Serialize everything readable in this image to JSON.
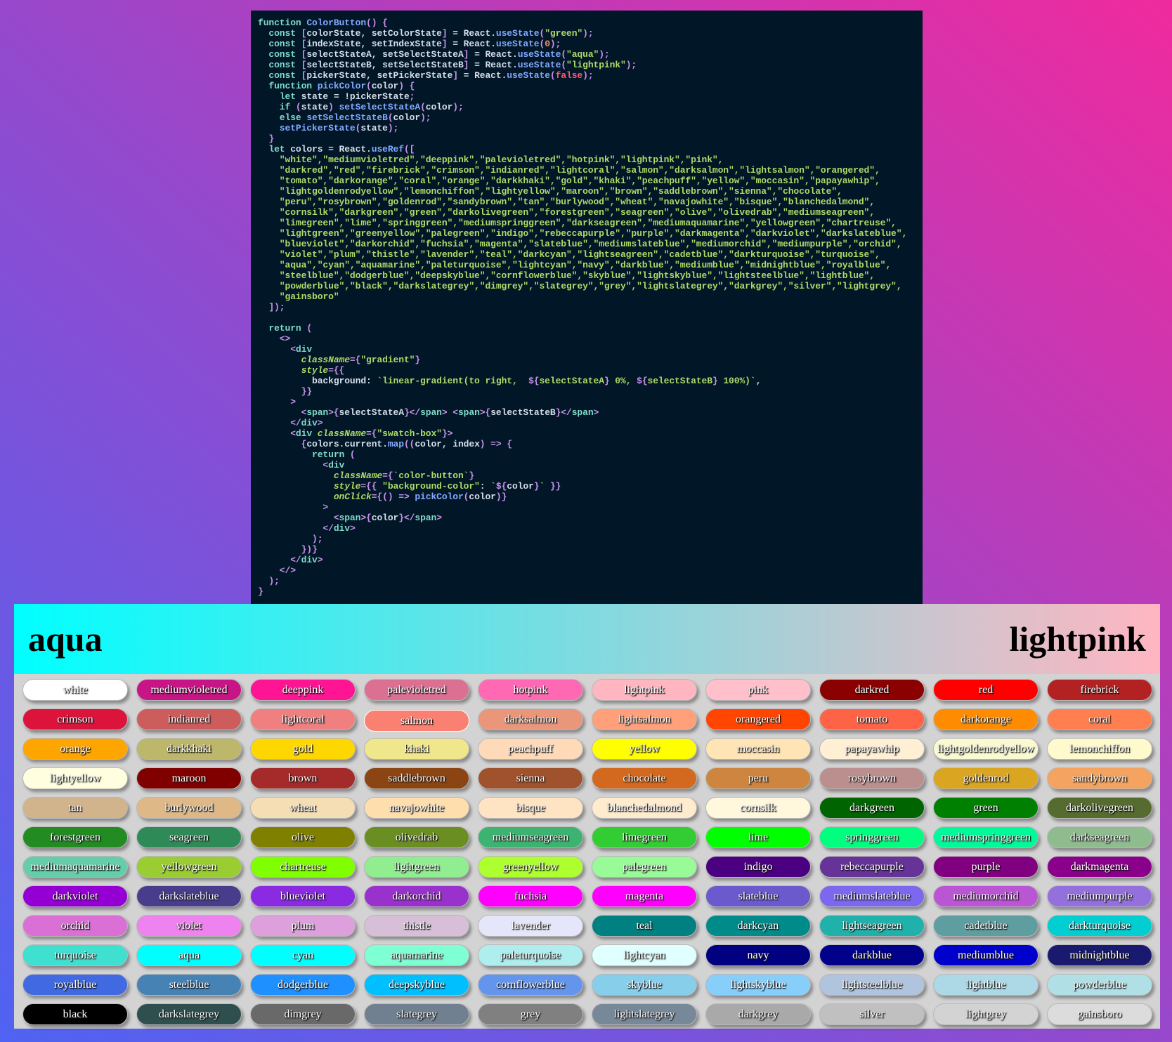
{
  "code_editor": {
    "lines": [
      [
        [
          "kw",
          "function "
        ],
        [
          "fn",
          "ColorButton"
        ],
        [
          "p",
          "() {"
        ]
      ],
      [
        [
          "kw",
          "  const "
        ],
        [
          "p",
          "["
        ],
        [
          "t",
          "colorState, setColorState"
        ],
        [
          "p",
          "]"
        ],
        [
          "t",
          " = React."
        ],
        [
          "fn",
          "useState"
        ],
        [
          "p",
          "("
        ],
        [
          "s",
          "\"green\""
        ],
        [
          "p",
          ");"
        ]
      ],
      [
        [
          "kw",
          "  const "
        ],
        [
          "p",
          "["
        ],
        [
          "t",
          "indexState, setIndexState"
        ],
        [
          "p",
          "]"
        ],
        [
          "t",
          " = React."
        ],
        [
          "fn",
          "useState"
        ],
        [
          "p",
          "("
        ],
        [
          "n",
          "0"
        ],
        [
          "p",
          ");"
        ]
      ],
      [
        [
          "kw",
          "  const "
        ],
        [
          "p",
          "["
        ],
        [
          "t",
          "selectStateA, setSelectStateA"
        ],
        [
          "p",
          "]"
        ],
        [
          "t",
          " = React."
        ],
        [
          "fn",
          "useState"
        ],
        [
          "p",
          "("
        ],
        [
          "s",
          "\"aqua\""
        ],
        [
          "p",
          ");"
        ]
      ],
      [
        [
          "kw",
          "  const "
        ],
        [
          "p",
          "["
        ],
        [
          "t",
          "selectStateB, setSelectStateB"
        ],
        [
          "p",
          "]"
        ],
        [
          "t",
          " = React."
        ],
        [
          "fn",
          "useState"
        ],
        [
          "p",
          "("
        ],
        [
          "s",
          "\"lightpink\""
        ],
        [
          "p",
          ");"
        ]
      ],
      [
        [
          "kw",
          "  const "
        ],
        [
          "p",
          "["
        ],
        [
          "t",
          "pickerState, setPickerState"
        ],
        [
          "p",
          "]"
        ],
        [
          "t",
          " = React."
        ],
        [
          "fn",
          "useState"
        ],
        [
          "p",
          "("
        ],
        [
          "b",
          "false"
        ],
        [
          "p",
          ");"
        ]
      ],
      [
        [
          "kw",
          "  function "
        ],
        [
          "fn",
          "pickColor"
        ],
        [
          "p",
          "("
        ],
        [
          "t",
          "color"
        ],
        [
          "p",
          ") {"
        ]
      ],
      [
        [
          "kw",
          "    let "
        ],
        [
          "t",
          "state = !pickerState"
        ],
        [
          "p",
          ";"
        ]
      ],
      [
        [
          "kw",
          "    if "
        ],
        [
          "p",
          "("
        ],
        [
          "t",
          "state"
        ],
        [
          "p",
          ") "
        ],
        [
          "fn",
          "setSelectStateA"
        ],
        [
          "p",
          "("
        ],
        [
          "t",
          "color"
        ],
        [
          "p",
          ");"
        ]
      ],
      [
        [
          "kw",
          "    else "
        ],
        [
          "fn",
          "setSelectStateB"
        ],
        [
          "p",
          "("
        ],
        [
          "t",
          "color"
        ],
        [
          "p",
          ");"
        ]
      ],
      [
        [
          "fn",
          "    setPickerState"
        ],
        [
          "p",
          "("
        ],
        [
          "t",
          "state"
        ],
        [
          "p",
          ");"
        ]
      ],
      [
        [
          "p",
          "  }"
        ]
      ],
      [
        [
          "kw",
          "  let "
        ],
        [
          "t",
          "colors = React."
        ],
        [
          "fn",
          "useRef"
        ],
        [
          "p",
          "(["
        ]
      ],
      [
        [
          "s",
          "    \"white\",\"mediumvioletred\",\"deeppink\",\"palevioletred\",\"hotpink\",\"lightpink\",\"pink\","
        ]
      ],
      [
        [
          "s",
          "    \"darkred\",\"red\",\"firebrick\",\"crimson\",\"indianred\",\"lightcoral\",\"salmon\",\"darksalmon\",\"lightsalmon\",\"orangered\","
        ]
      ],
      [
        [
          "s",
          "    \"tomato\",\"darkorange\",\"coral\",\"orange\",\"darkkhaki\",\"gold\",\"khaki\",\"peachpuff\",\"yellow\",\"moccasin\",\"papayawhip\","
        ]
      ],
      [
        [
          "s",
          "    \"lightgoldenrodyellow\",\"lemonchiffon\",\"lightyellow\",\"maroon\",\"brown\",\"saddlebrown\",\"sienna\",\"chocolate\","
        ]
      ],
      [
        [
          "s",
          "    \"peru\",\"rosybrown\",\"goldenrod\",\"sandybrown\",\"tan\",\"burlywood\",\"wheat\",\"navajowhite\",\"bisque\",\"blanchedalmond\","
        ]
      ],
      [
        [
          "s",
          "    \"cornsilk\",\"darkgreen\",\"green\",\"darkolivegreen\",\"forestgreen\",\"seagreen\",\"olive\",\"olivedrab\",\"mediumseagreen\","
        ]
      ],
      [
        [
          "s",
          "    \"limegreen\",\"lime\",\"springgreen\",\"mediumspringgreen\",\"darkseagreen\",\"mediumaquamarine\",\"yellowgreen\",\"chartreuse\","
        ]
      ],
      [
        [
          "s",
          "    \"lightgreen\",\"greenyellow\",\"palegreen\",\"indigo\",\"rebeccapurple\",\"purple\",\"darkmagenta\",\"darkviolet\",\"darkslateblue\","
        ]
      ],
      [
        [
          "s",
          "    \"blueviolet\",\"darkorchid\",\"fuchsia\",\"magenta\",\"slateblue\",\"mediumslateblue\",\"mediumorchid\",\"mediumpurple\",\"orchid\","
        ]
      ],
      [
        [
          "s",
          "    \"violet\",\"plum\",\"thistle\",\"lavender\",\"teal\",\"darkcyan\",\"lightseagreen\",\"cadetblue\",\"darkturquoise\",\"turquoise\","
        ]
      ],
      [
        [
          "s",
          "    \"aqua\",\"cyan\",\"aquamarine\",\"paleturquoise\",\"lightcyan\",\"navy\",\"darkblue\",\"mediumblue\",\"midnightblue\",\"royalblue\","
        ]
      ],
      [
        [
          "s",
          "    \"steelblue\",\"dodgerblue\",\"deepskyblue\",\"cornflowerblue\",\"skyblue\",\"lightskyblue\",\"lightsteelblue\",\"lightblue\","
        ]
      ],
      [
        [
          "s",
          "    \"powderblue\",\"black\",\"darkslategrey\",\"dimgrey\",\"slategrey\",\"grey\",\"lightslategrey\",\"darkgrey\",\"silver\",\"lightgrey\","
        ]
      ],
      [
        [
          "s",
          "    \"gainsboro\""
        ]
      ],
      [
        [
          "p",
          "  ]);"
        ]
      ],
      [
        [
          "t",
          ""
        ]
      ],
      [
        [
          "kw",
          "  return "
        ],
        [
          "p",
          "("
        ]
      ],
      [
        [
          "p",
          "    <>"
        ]
      ],
      [
        [
          "p",
          "      <"
        ],
        [
          "tag",
          "div"
        ]
      ],
      [
        [
          "a",
          "        className"
        ],
        [
          "p",
          "={"
        ],
        [
          "s",
          "\"gradient\""
        ],
        [
          "p",
          "}"
        ]
      ],
      [
        [
          "a",
          "        style"
        ],
        [
          "p",
          "={{"
        ]
      ],
      [
        [
          "t",
          "          background: "
        ],
        [
          "s",
          "`linear-gradient(to right,  "
        ],
        [
          "p",
          "${"
        ],
        [
          "s",
          "selectStateA"
        ],
        [
          "p",
          "}"
        ],
        [
          "s",
          " 0%, "
        ],
        [
          "p",
          "${"
        ],
        [
          "s",
          "selectStateB"
        ],
        [
          "p",
          "}"
        ],
        [
          "s",
          " 100%)`"
        ],
        [
          "t",
          ","
        ]
      ],
      [
        [
          "p",
          "        }}"
        ]
      ],
      [
        [
          "p",
          "      >"
        ]
      ],
      [
        [
          "p",
          "        <"
        ],
        [
          "tag",
          "span"
        ],
        [
          "p",
          ">{"
        ],
        [
          "t",
          "selectStateA"
        ],
        [
          "p",
          "}</"
        ],
        [
          "tag",
          "span"
        ],
        [
          "p",
          "> <"
        ],
        [
          "tag",
          "span"
        ],
        [
          "p",
          ">{"
        ],
        [
          "t",
          "selectStateB"
        ],
        [
          "p",
          "}</"
        ],
        [
          "tag",
          "span"
        ],
        [
          "p",
          ">"
        ]
      ],
      [
        [
          "p",
          "      </"
        ],
        [
          "tag",
          "div"
        ],
        [
          "p",
          ">"
        ]
      ],
      [
        [
          "p",
          "      <"
        ],
        [
          "tag",
          "div "
        ],
        [
          "a",
          "className"
        ],
        [
          "p",
          "={"
        ],
        [
          "s",
          "\"swatch-box\""
        ],
        [
          "p",
          "}>"
        ]
      ],
      [
        [
          "p",
          "        {"
        ],
        [
          "t",
          "colors.current."
        ],
        [
          "fn",
          "map"
        ],
        [
          "p",
          "(("
        ],
        [
          "t",
          "color, index"
        ],
        [
          "p",
          ") => {"
        ]
      ],
      [
        [
          "kw",
          "          return "
        ],
        [
          "p",
          "("
        ]
      ],
      [
        [
          "p",
          "            <"
        ],
        [
          "tag",
          "div"
        ]
      ],
      [
        [
          "a",
          "              className"
        ],
        [
          "p",
          "={"
        ],
        [
          "s",
          "`color-button`"
        ],
        [
          "p",
          "}"
        ]
      ],
      [
        [
          "a",
          "              style"
        ],
        [
          "p",
          "={{ "
        ],
        [
          "s",
          "\"background-color\""
        ],
        [
          "t",
          ": "
        ],
        [
          "s",
          "`"
        ],
        [
          "p",
          "${"
        ],
        [
          "t",
          "color"
        ],
        [
          "p",
          "}"
        ],
        [
          "s",
          "`"
        ],
        [
          "p",
          " }}"
        ]
      ],
      [
        [
          "a",
          "              onClick"
        ],
        [
          "p",
          "={() => "
        ],
        [
          "fn",
          "pickColor"
        ],
        [
          "p",
          "("
        ],
        [
          "t",
          "color"
        ],
        [
          "p",
          ")}"
        ]
      ],
      [
        [
          "p",
          "            >"
        ]
      ],
      [
        [
          "p",
          "              <"
        ],
        [
          "tag",
          "span"
        ],
        [
          "p",
          ">{"
        ],
        [
          "t",
          "color"
        ],
        [
          "p",
          "}</"
        ],
        [
          "tag",
          "span"
        ],
        [
          "p",
          ">"
        ]
      ],
      [
        [
          "p",
          "            </"
        ],
        [
          "tag",
          "div"
        ],
        [
          "p",
          ">"
        ]
      ],
      [
        [
          "p",
          "          );"
        ]
      ],
      [
        [
          "p",
          "        })}"
        ]
      ],
      [
        [
          "p",
          "      </"
        ],
        [
          "tag",
          "div"
        ],
        [
          "p",
          ">"
        ]
      ],
      [
        [
          "p",
          "    </>"
        ]
      ],
      [
        [
          "p",
          "  );"
        ]
      ],
      [
        [
          "p",
          "}"
        ]
      ]
    ]
  },
  "gradient": {
    "selectStateA": "aqua",
    "selectStateB": "lightpink"
  },
  "swatch_box": {
    "active_color": "salmon",
    "colors": [
      "white",
      "mediumvioletred",
      "deeppink",
      "palevioletred",
      "hotpink",
      "lightpink",
      "pink",
      "darkred",
      "red",
      "firebrick",
      "crimson",
      "indianred",
      "lightcoral",
      "salmon",
      "darksalmon",
      "lightsalmon",
      "orangered",
      "tomato",
      "darkorange",
      "coral",
      "orange",
      "darkkhaki",
      "gold",
      "khaki",
      "peachpuff",
      "yellow",
      "moccasin",
      "papayawhip",
      "lightgoldenrodyellow",
      "lemonchiffon",
      "lightyellow",
      "maroon",
      "brown",
      "saddlebrown",
      "sienna",
      "chocolate",
      "peru",
      "rosybrown",
      "goldenrod",
      "sandybrown",
      "tan",
      "burlywood",
      "wheat",
      "navajowhite",
      "bisque",
      "blanchedalmond",
      "cornsilk",
      "darkgreen",
      "green",
      "darkolivegreen",
      "forestgreen",
      "seagreen",
      "olive",
      "olivedrab",
      "mediumseagreen",
      "limegreen",
      "lime",
      "springgreen",
      "mediumspringgreen",
      "darkseagreen",
      "mediumaquamarine",
      "yellowgreen",
      "chartreuse",
      "lightgreen",
      "greenyellow",
      "palegreen",
      "indigo",
      "rebeccapurple",
      "purple",
      "darkmagenta",
      "darkviolet",
      "darkslateblue",
      "blueviolet",
      "darkorchid",
      "fuchsia",
      "magenta",
      "slateblue",
      "mediumslateblue",
      "mediumorchid",
      "mediumpurple",
      "orchid",
      "violet",
      "plum",
      "thistle",
      "lavender",
      "teal",
      "darkcyan",
      "lightseagreen",
      "cadetblue",
      "darkturquoise",
      "turquoise",
      "aqua",
      "cyan",
      "aquamarine",
      "paleturquoise",
      "lightcyan",
      "navy",
      "darkblue",
      "mediumblue",
      "midnightblue",
      "royalblue",
      "steelblue",
      "dodgerblue",
      "deepskyblue",
      "cornflowerblue",
      "skyblue",
      "lightskyblue",
      "lightsteelblue",
      "lightblue",
      "powderblue",
      "black",
      "darkslategrey",
      "dimgrey",
      "slategrey",
      "grey",
      "lightslategrey",
      "darkgrey",
      "silver",
      "lightgrey",
      "gainsboro"
    ]
  }
}
